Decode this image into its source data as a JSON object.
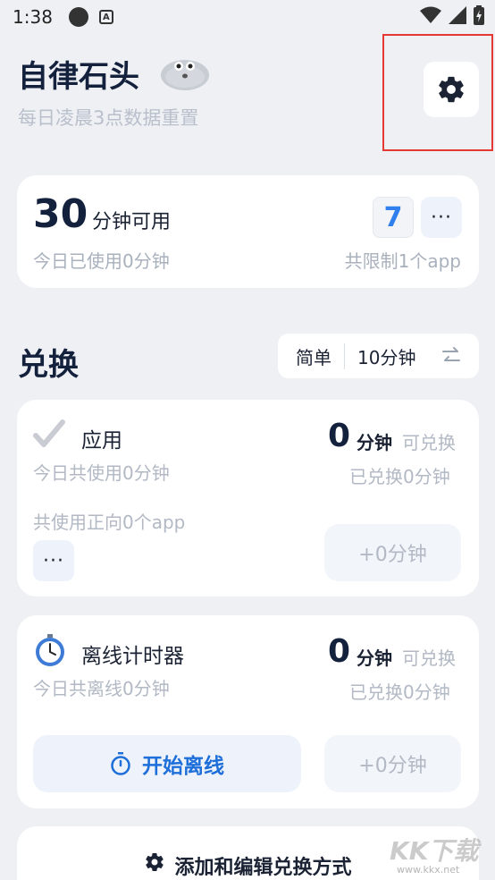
{
  "status_bar": {
    "time": "1:38",
    "a_icon": "A"
  },
  "header": {
    "title": "自律石头",
    "subtitle": "每日凌晨3点数据重置"
  },
  "summary": {
    "minutes": "30",
    "minutes_label": "分钟可用",
    "used_today": "今日已使用0分钟",
    "badge": "7",
    "more": "···",
    "limit_text": "共限制1个app"
  },
  "exchange": {
    "section_title": "兑换",
    "mode_simple": "简单",
    "mode_time": "10分钟"
  },
  "cards": [
    {
      "title": "应用",
      "sub1": "今日共使用0分钟",
      "sub2": "共使用正向0个app",
      "value": "0",
      "unit": "分钟",
      "exchangeable": "可兑换",
      "exchanged": "已兑换0分钟",
      "more": "···",
      "plus": "+0分钟"
    },
    {
      "title": "离线计时器",
      "sub1": "今日共离线0分钟",
      "value": "0",
      "unit": "分钟",
      "exchangeable": "可兑换",
      "exchanged": "已兑换0分钟",
      "start": "开始离线",
      "plus": "+0分钟"
    }
  ],
  "add_edit": "添加和编辑兑换方式",
  "watermark": {
    "brand": "KK下载",
    "url": "www.kkx.net"
  },
  "colors": {
    "accent": "#1e6fd9",
    "badge": "#2f80ed",
    "highlight": "#e53935"
  }
}
